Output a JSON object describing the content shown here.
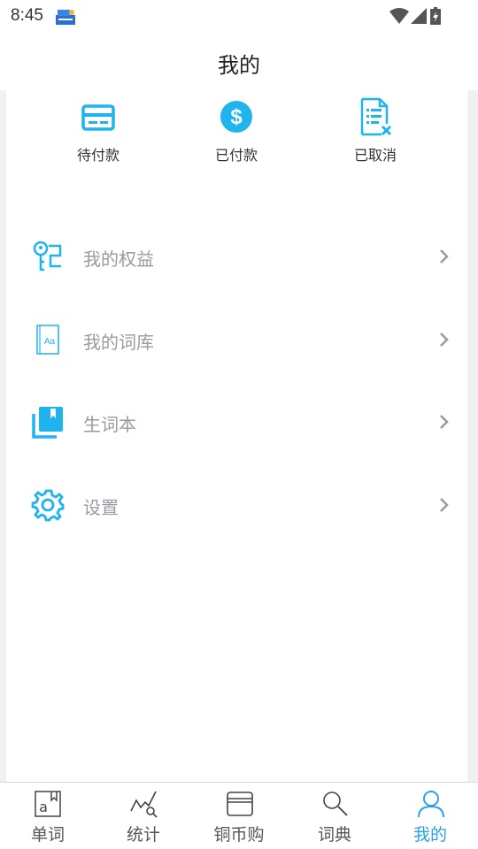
{
  "status_bar": {
    "time": "8:45"
  },
  "header": {
    "title": "我的"
  },
  "orders": [
    {
      "label": "待付款",
      "icon": "card-icon"
    },
    {
      "label": "已付款",
      "icon": "dollar-icon"
    },
    {
      "label": "已取消",
      "icon": "cancel-document-icon"
    }
  ],
  "menu": [
    {
      "label": "我的权益",
      "icon": "key-icon"
    },
    {
      "label": "我的词库",
      "icon": "book-icon"
    },
    {
      "label": "生词本",
      "icon": "bookmark-icon"
    },
    {
      "label": "设置",
      "icon": "gear-icon"
    }
  ],
  "bottom_nav": [
    {
      "label": "单词",
      "icon": "word-book-icon"
    },
    {
      "label": "统计",
      "icon": "chart-search-icon"
    },
    {
      "label": "铜币购",
      "icon": "wallet-icon"
    },
    {
      "label": "词典",
      "icon": "search-icon"
    },
    {
      "label": "我的",
      "icon": "person-icon",
      "active": true
    }
  ],
  "colors": {
    "accent": "#1fb4ee",
    "nav_active": "#2aa3e6"
  }
}
